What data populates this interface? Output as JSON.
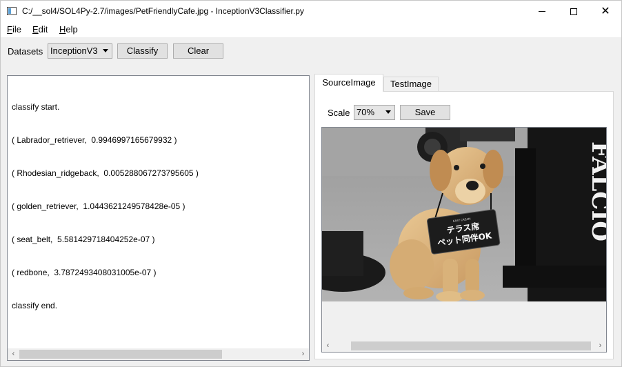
{
  "window": {
    "title": "C:/__sol4/SOL4Py-2.7/images/PetFriendlyCafe.jpg - InceptionV3Classifier.py"
  },
  "menu": {
    "file": {
      "accel": "F",
      "rest": "ile"
    },
    "edit": {
      "accel": "E",
      "rest": "dit"
    },
    "help": {
      "accel": "H",
      "rest": "elp"
    }
  },
  "toolbar": {
    "datasets_label": "Datasets",
    "dataset_selected": "InceptionV3",
    "classify_label": "Classify",
    "clear_label": "Clear"
  },
  "log": {
    "lines": [
      "classify start.",
      "( Labrador_retriever,  0.9946997165679932 )",
      "( Rhodesian_ridgeback,  0.005288067273795605 )",
      "( golden_retriever,  1.0443621249578428e-05 )",
      "( seat_belt,  5.581429718404252e-07 )",
      "( redbone,  3.7872493408031005e-07 )",
      "classify end."
    ]
  },
  "tabs": {
    "source": "SourceImage",
    "test": "TestImage"
  },
  "image_panel": {
    "scale_label": "Scale",
    "scale_selected": "70%",
    "save_label": "Save"
  },
  "photo": {
    "sign_line1": "テラス席",
    "sign_line2": "ペット同伴OK",
    "sign_small": "EASY CREAM",
    "pillar_text": "FALCIO"
  },
  "icons": {
    "left_arrow": "‹",
    "right_arrow": "›"
  }
}
